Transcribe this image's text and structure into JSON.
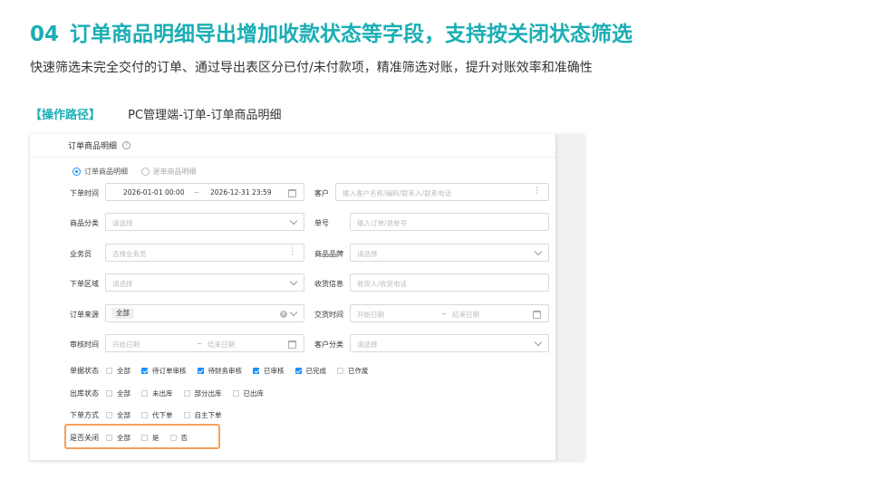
{
  "slide": {
    "number": "04",
    "title": "订单商品明细导出增加收款状态等字段，支持按关闭状态筛选",
    "subtitle": "快速筛选未完全交付的订单、通过导出表区分已付/未付款项，精准筛选对账，提升对账效率和准确性",
    "path_label": "【操作路径】",
    "path_value": "PC管理端-订单-订单商品明细"
  },
  "panel": {
    "title": "订单商品明细",
    "help_symbol": "?",
    "radios": [
      {
        "label": "订单商品明细",
        "selected": true
      },
      {
        "label": "退单商品明细",
        "selected": false
      }
    ],
    "fields": {
      "order_time": {
        "label": "下单时间",
        "start": "2026-01-01 00:00",
        "sep": "~",
        "end": "2026-12-31 23:59"
      },
      "customer": {
        "label": "客户",
        "placeholder": "输入客户名称/编码/联系人/联系电话"
      },
      "category": {
        "label": "商品分类",
        "placeholder": "请选择"
      },
      "order_no": {
        "label": "单号",
        "placeholder": "输入订单/退单号"
      },
      "salesman": {
        "label": "业务员",
        "placeholder": "选择业务员"
      },
      "brand": {
        "label": "商品品牌",
        "placeholder": "请选择"
      },
      "region": {
        "label": "下单区域",
        "placeholder": "请选择"
      },
      "receiver": {
        "label": "收货信息",
        "placeholder": "收货人/收货电话"
      },
      "source": {
        "label": "订单来源",
        "value": "全部"
      },
      "delivery_time": {
        "label": "交货时间",
        "start_ph": "开始日期",
        "sep": "~",
        "end_ph": "结束日期"
      },
      "audit_time": {
        "label": "审核时间",
        "start_ph": "开始日期",
        "sep": "~",
        "end_ph": "结束日期"
      },
      "customer_type": {
        "label": "客户分类",
        "placeholder": "请选择"
      }
    },
    "filters": {
      "doc_status": {
        "label": "单据状态",
        "options": [
          {
            "label": "全部",
            "checked": false
          },
          {
            "label": "待订单审核",
            "checked": true
          },
          {
            "label": "待财务审核",
            "checked": true
          },
          {
            "label": "已审核",
            "checked": true
          },
          {
            "label": "已完成",
            "checked": true
          },
          {
            "label": "已作废",
            "checked": false
          }
        ]
      },
      "stock_status": {
        "label": "出库状态",
        "options": [
          {
            "label": "全部",
            "checked": false
          },
          {
            "label": "未出库",
            "checked": false
          },
          {
            "label": "部分出库",
            "checked": false
          },
          {
            "label": "已出库",
            "checked": false
          }
        ]
      },
      "order_mode": {
        "label": "下单方式",
        "options": [
          {
            "label": "全部",
            "checked": false
          },
          {
            "label": "代下单",
            "checked": false
          },
          {
            "label": "自主下单",
            "checked": false
          }
        ]
      },
      "closed": {
        "label": "是否关闭",
        "options": [
          {
            "label": "全部",
            "checked": false
          },
          {
            "label": "是",
            "checked": false
          },
          {
            "label": "否",
            "checked": false
          }
        ]
      }
    }
  },
  "colors": {
    "accent": "#1aaeb4",
    "primary": "#1890ff",
    "highlight": "#f5a15a"
  }
}
